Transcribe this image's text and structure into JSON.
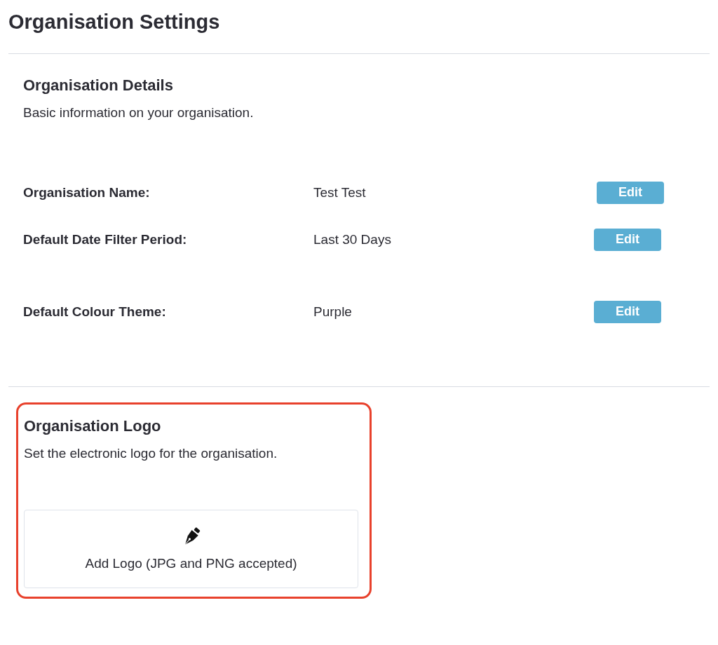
{
  "page_title": "Organisation Settings",
  "details": {
    "heading": "Organisation Details",
    "description": "Basic information on your organisation.",
    "rows": [
      {
        "label": "Organisation Name:",
        "value": "Test Test",
        "button": "Edit"
      },
      {
        "label": "Default Date Filter Period:",
        "value": "Last 30 Days",
        "button": "Edit"
      },
      {
        "label": "Default Colour Theme:",
        "value": "Purple",
        "button": "Edit"
      }
    ]
  },
  "logo": {
    "heading": "Organisation Logo",
    "description": "Set the electronic logo for the organisation.",
    "upload_label": "Add Logo (JPG and PNG accepted)"
  }
}
